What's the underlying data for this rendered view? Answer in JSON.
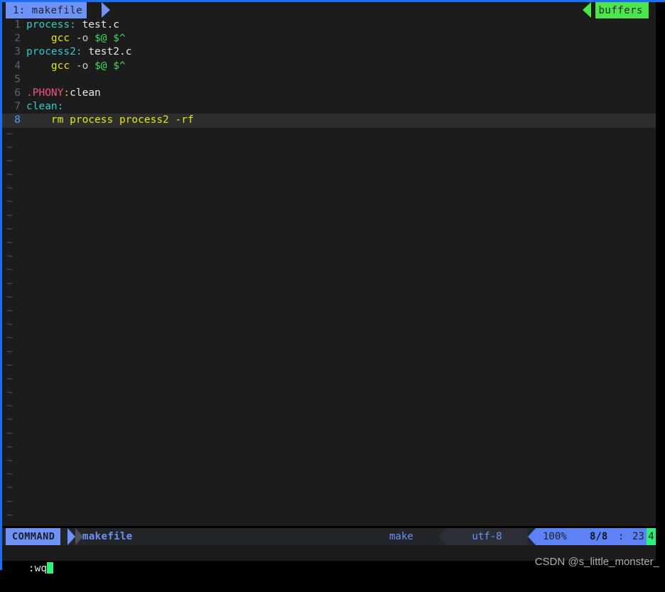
{
  "app": {
    "name": "vim",
    "accent_blue": "#6e92f5",
    "accent_green": "#4ee44e",
    "background": "#1c1c1c",
    "frame_color": "#1b6ef5"
  },
  "tabline": {
    "tab_label": "1: makefile",
    "buffers_label": "buffers"
  },
  "editor": {
    "lines": [
      {
        "num": "1",
        "tokens": [
          {
            "text": "process:",
            "cls": "t-target"
          },
          {
            "text": " ",
            "cls": "t-plain"
          },
          {
            "text": "test.c",
            "cls": "t-dep"
          }
        ]
      },
      {
        "num": "2",
        "tokens": [
          {
            "text": "    ",
            "cls": "t-plain"
          },
          {
            "text": "gcc",
            "cls": "t-cmd"
          },
          {
            "text": " ",
            "cls": "t-plain"
          },
          {
            "text": "-o",
            "cls": "t-flag"
          },
          {
            "text": " ",
            "cls": "t-plain"
          },
          {
            "text": "$@",
            "cls": "t-auto"
          },
          {
            "text": " ",
            "cls": "t-plain"
          },
          {
            "text": "$^",
            "cls": "t-auto"
          }
        ]
      },
      {
        "num": "3",
        "tokens": [
          {
            "text": "process2:",
            "cls": "t-target"
          },
          {
            "text": " ",
            "cls": "t-plain"
          },
          {
            "text": "test2.c",
            "cls": "t-dep"
          }
        ]
      },
      {
        "num": "4",
        "tokens": [
          {
            "text": "    ",
            "cls": "t-plain"
          },
          {
            "text": "gcc",
            "cls": "t-cmd"
          },
          {
            "text": " ",
            "cls": "t-plain"
          },
          {
            "text": "-o",
            "cls": "t-flag"
          },
          {
            "text": " ",
            "cls": "t-plain"
          },
          {
            "text": "$@",
            "cls": "t-auto"
          },
          {
            "text": " ",
            "cls": "t-plain"
          },
          {
            "text": "$^",
            "cls": "t-auto"
          }
        ]
      },
      {
        "num": "5",
        "tokens": []
      },
      {
        "num": "6",
        "tokens": [
          {
            "text": ".PHONY",
            "cls": "t-special"
          },
          {
            "text": ":",
            "cls": "t-colon"
          },
          {
            "text": "clean",
            "cls": "t-dep"
          }
        ]
      },
      {
        "num": "7",
        "tokens": [
          {
            "text": "clean:",
            "cls": "t-target"
          }
        ]
      },
      {
        "num": "8",
        "current": true,
        "tokens": [
          {
            "text": "    rm process process2 -rf",
            "cls": "t-yellow"
          }
        ]
      }
    ],
    "filler_char": "~",
    "filler_count": 29
  },
  "statusline": {
    "mode": "COMMAND",
    "filename": "makefile",
    "filetype": "make",
    "encoding": "utf-8",
    "percent": "100%",
    "line_position": "8/8",
    "separator": ":",
    "column": "23",
    "column_cursor": "4"
  },
  "cmdline": {
    "text": ":wq"
  },
  "watermark": {
    "text": "CSDN @s_little_monster_"
  }
}
